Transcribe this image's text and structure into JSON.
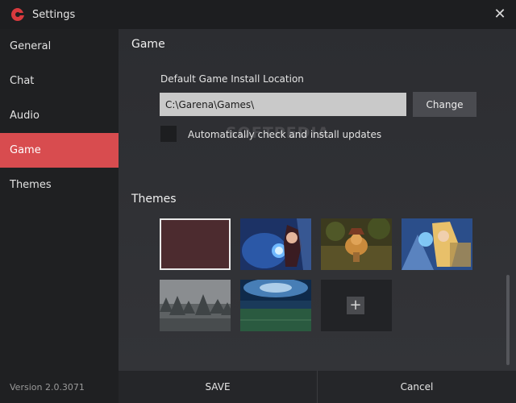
{
  "window": {
    "title": "Settings"
  },
  "sidebar": {
    "items": [
      {
        "label": "General"
      },
      {
        "label": "Chat"
      },
      {
        "label": "Audio"
      },
      {
        "label": "Game",
        "active": true
      },
      {
        "label": "Themes"
      }
    ],
    "version": "Version 2.0.3071"
  },
  "game": {
    "section_title": "Game",
    "install_label": "Default Game Install Location",
    "install_path": "C:\\Garena\\Games\\",
    "change_label": "Change",
    "auto_update_label": "Automatically check and install updates",
    "auto_update_checked": false
  },
  "themes": {
    "section_title": "Themes",
    "items": [
      {
        "name": "solid-maroon",
        "color": "#4c2b2f",
        "selected": true
      },
      {
        "name": "blue-fox-champion",
        "color": "#1e3f7a",
        "selected": false
      },
      {
        "name": "yordle-forest",
        "color": "#6a5a30",
        "selected": false
      },
      {
        "name": "blonde-champion",
        "color": "#4a6a9a",
        "selected": false
      },
      {
        "name": "misty-forest",
        "color": "#5a5d60",
        "selected": false
      },
      {
        "name": "stadium-lights",
        "color": "#1c3a2e",
        "selected": false
      }
    ],
    "add_icon": "plus-icon"
  },
  "watermark": "SOFTPEDIA",
  "footer": {
    "save_label": "SAVE",
    "cancel_label": "Cancel"
  },
  "colors": {
    "accent": "#d84c4f",
    "sidebar_bg": "#1f2022",
    "main_bg": "#2f3034"
  }
}
